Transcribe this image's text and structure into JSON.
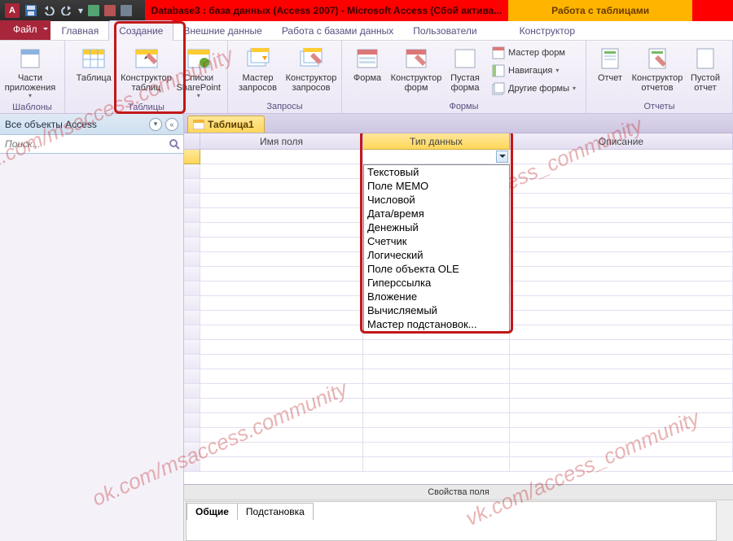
{
  "titlebar": {
    "app_letter": "A",
    "document_title": "Database3 : база данных (Access 2007)  -  Microsoft Access (Сбой актива...",
    "contextual_title": "Работа с таблицами"
  },
  "tabs": {
    "file": "Файл",
    "home": "Главная",
    "create": "Создание",
    "external": "Внешние данные",
    "dbtools": "Работа с базами данных",
    "users": "Пользователи",
    "designer": "Конструктор"
  },
  "ribbon": {
    "templates": {
      "label": "Шаблоны",
      "app_parts": "Части\nприложения"
    },
    "tables": {
      "label": "Таблицы",
      "table": "Таблица",
      "table_designer": "Конструктор\nтаблиц",
      "sharepoint": "Списки\nSharePoint"
    },
    "queries": {
      "label": "Запросы",
      "wizard": "Мастер\nзапросов",
      "designer": "Конструктор\nзапросов"
    },
    "forms": {
      "label": "Формы",
      "form": "Форма",
      "form_designer": "Конструктор\nформ",
      "blank": "Пустая\nформа",
      "form_wizard": "Мастер форм",
      "navigation": "Навигация",
      "other": "Другие формы"
    },
    "reports": {
      "label": "Отчеты",
      "report": "Отчет",
      "report_designer": "Конструктор\nотчетов",
      "blank": "Пустой\nотчет"
    }
  },
  "nav": {
    "title": "Все объекты Access",
    "search_placeholder": "Поиск..."
  },
  "doc_tab": "Таблица1",
  "grid": {
    "col_name": "Имя поля",
    "col_type": "Тип данных",
    "col_desc": "Описание"
  },
  "type_options": [
    "Текстовый",
    "Поле МЕМО",
    "Числовой",
    "Дата/время",
    "Денежный",
    "Счетчик",
    "Логический",
    "Поле объекта OLE",
    "Гиперссылка",
    "Вложение",
    "Вычисляемый",
    "Мастер подстановок..."
  ],
  "propsheet": {
    "title": "Свойства поля",
    "tab_general": "Общие",
    "tab_lookup": "Подстановка"
  },
  "watermarks": [
    "ok.com/msaccess.community",
    "vk.com/access_community",
    "ok.com/msaccess.community",
    "vk.com/access_community"
  ]
}
